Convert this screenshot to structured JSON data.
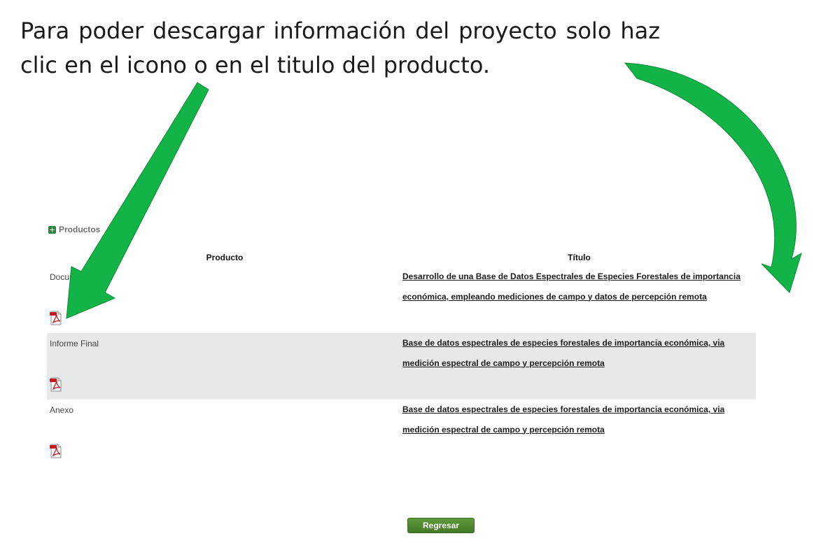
{
  "instruction": {
    "text": "Para poder descargar información del proyecto solo haz clic en el icono o en el titulo del producto."
  },
  "section": {
    "title": "Productos",
    "icon": "expand-icon"
  },
  "table": {
    "headers": {
      "product": "Producto",
      "title": "Título"
    },
    "rows": [
      {
        "product": "Documento",
        "icon": "pdf-icon",
        "title": "Desarrollo de una Base de Datos Espectrales de Especies Forestales de importancia económica, empleando mediciones de campo y datos de percepción remota"
      },
      {
        "product": "Informe Final",
        "icon": "pdf-icon",
        "title": "Base de datos espectrales de especies forestales de importancia económica, via medición espectral de campo y percepción remota"
      },
      {
        "product": "Anexo",
        "icon": "pdf-icon",
        "title": "Base de datos espectrales de especies forestales de importancia económica, via medición espectral de campo y percepción remota"
      }
    ]
  },
  "back_button": {
    "label": "Regresar"
  },
  "colors": {
    "arrow_green": "#12b347",
    "button_green": "#4e8a31",
    "alt_row": "#e7e8ea",
    "section_icon": "#1f8a3d"
  }
}
